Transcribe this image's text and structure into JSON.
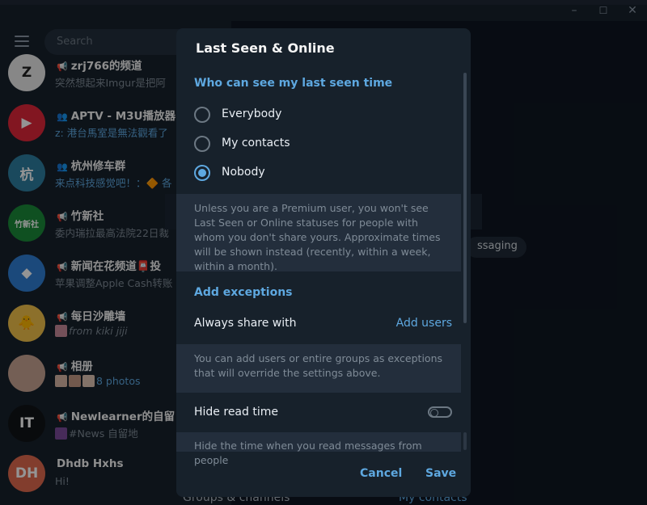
{
  "window": {
    "minimize_glyph": "–",
    "maximize_glyph": "☐",
    "close_glyph": "✕"
  },
  "sidebar": {
    "search_placeholder": "Search",
    "chats": [
      {
        "kind": "channel",
        "kind_glyph": "📢",
        "name": "zrj766的频道",
        "subtitle": "突然想起来Imgur是把阿",
        "avatar_text": "Z",
        "avatar_color": "#e8e8e8"
      },
      {
        "kind": "group",
        "kind_glyph": "👥",
        "name": "APTV - M3U播放器",
        "subtitle": "z: 港台馬室是無法觀看了",
        "avatar_text": "▶",
        "avatar_color": "#e0263a"
      },
      {
        "kind": "group",
        "kind_glyph": "👥",
        "name": "杭州修车群",
        "subtitle": "来点科技感觉吧！：🔶 各",
        "avatar_text": "杭",
        "avatar_color": "#2e7fa0"
      },
      {
        "kind": "channel",
        "kind_glyph": "📢",
        "name": "竹新社",
        "subtitle": "委内瑞拉最高法院22日裁",
        "avatar_text": "竹新社",
        "avatar_color": "#1a8a3a"
      },
      {
        "kind": "channel",
        "kind_glyph": "📢",
        "name": "新闻在花频道📮投",
        "subtitle": "苹果调整Apple Cash转账",
        "avatar_text": "◆",
        "avatar_color": "#2f7fd4"
      },
      {
        "kind": "channel",
        "kind_glyph": "📢",
        "name": "每日沙雕墙",
        "subtitle_prefix": "from kiki jiji",
        "subtitle": "",
        "avatar_text": "🐥",
        "avatar_color": "#f1c24a"
      },
      {
        "kind": "channel",
        "kind_glyph": "📢",
        "name": "相册",
        "subtitle": "8 photos",
        "avatar_text": "",
        "avatar_color": "#c9a493"
      },
      {
        "kind": "channel",
        "kind_glyph": "📢",
        "name": "Newlearner的自留",
        "subtitle": "#News  自留地",
        "avatar_text": "IT",
        "avatar_color": "#101418"
      },
      {
        "kind": "user",
        "kind_glyph": "",
        "name": "Dhdb Hxhs",
        "subtitle": "Hi!",
        "avatar_text": "DH",
        "avatar_color": "#e06a4e"
      }
    ]
  },
  "background": {
    "pill_text": "ssaging",
    "bottom_left_text": "Groups & channels",
    "bottom_right_text": "My contacts"
  },
  "dialog": {
    "title": "Last Seen & Online",
    "section_who": "Who can see my last seen time",
    "options": [
      {
        "label": "Everybody",
        "selected": false
      },
      {
        "label": "My contacts",
        "selected": false
      },
      {
        "label": "Nobody",
        "selected": true
      }
    ],
    "note_premium": "Unless you are a Premium user, you won't see Last Seen or Online statuses for people with whom you don't share yours. Approximate times will be shown instead (recently, within a week, within a month).",
    "section_exceptions": "Add exceptions",
    "always_share_label": "Always share with",
    "add_users_label": "Add users",
    "note_exceptions": "You can add users or entire groups as exceptions that will override the settings above.",
    "hide_read_label": "Hide read time",
    "hide_read_enabled": false,
    "note_hide_read": "Hide the time when you read messages from people",
    "cancel_label": "Cancel",
    "save_label": "Save"
  },
  "colors": {
    "accent": "#5ea8e0",
    "panel": "#17212b",
    "note_bg": "#232e3c"
  }
}
